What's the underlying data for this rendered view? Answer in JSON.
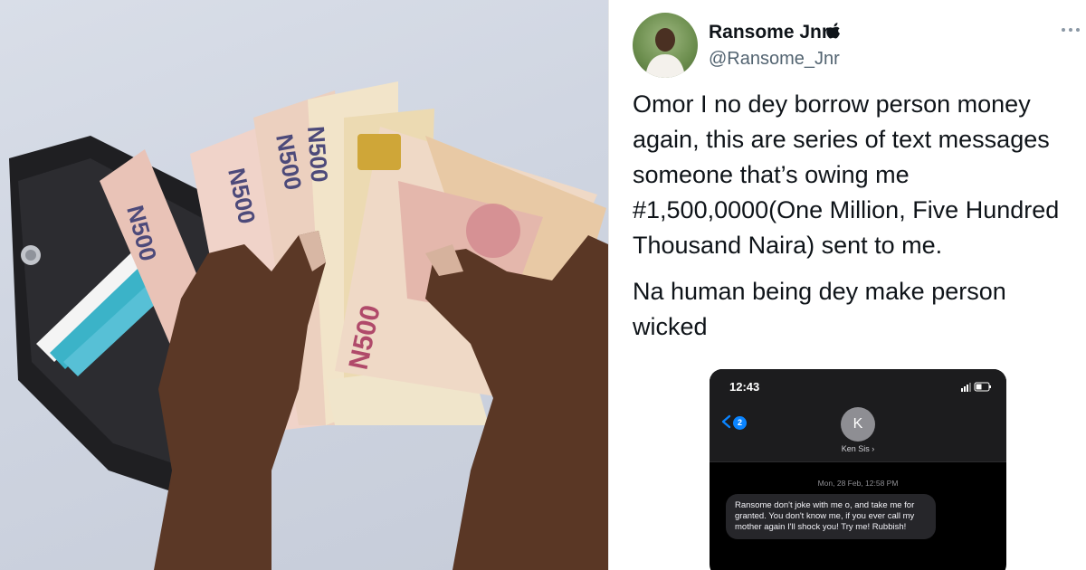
{
  "tweet": {
    "display_name": "Ransome Jnr",
    "handle": "@Ransome_Jnr",
    "paragraphs": [
      "Omor I no dey borrow person money again, this are series of text messages someone that’s owing me #1,500,0000(One Million, Five Hundred Thousand Naira) sent to me.",
      "Na human being dey make person wicked"
    ],
    "icons": {
      "verified_badge": "apple-icon",
      "menu": "more-options-icon"
    }
  },
  "phone_screenshot": {
    "time": "12:43",
    "back_badge_count": "2",
    "contact_initial": "K",
    "contact_name": "Ken Sis ›",
    "message_date": "Mon, 28 Feb, 12:58 PM",
    "message_text": "Ransome don't joke with me o, and take me for granted. You don't know me, if you ever call my mother again I'll shock you! Try me! Rubbish!"
  },
  "photo": {
    "subject": "hands-holding-naira-notes",
    "note_label": "N500"
  },
  "colors": {
    "text_primary": "#0f1419",
    "text_secondary": "#536471",
    "ios_blue": "#0a84ff",
    "phone_bg": "#000000"
  }
}
